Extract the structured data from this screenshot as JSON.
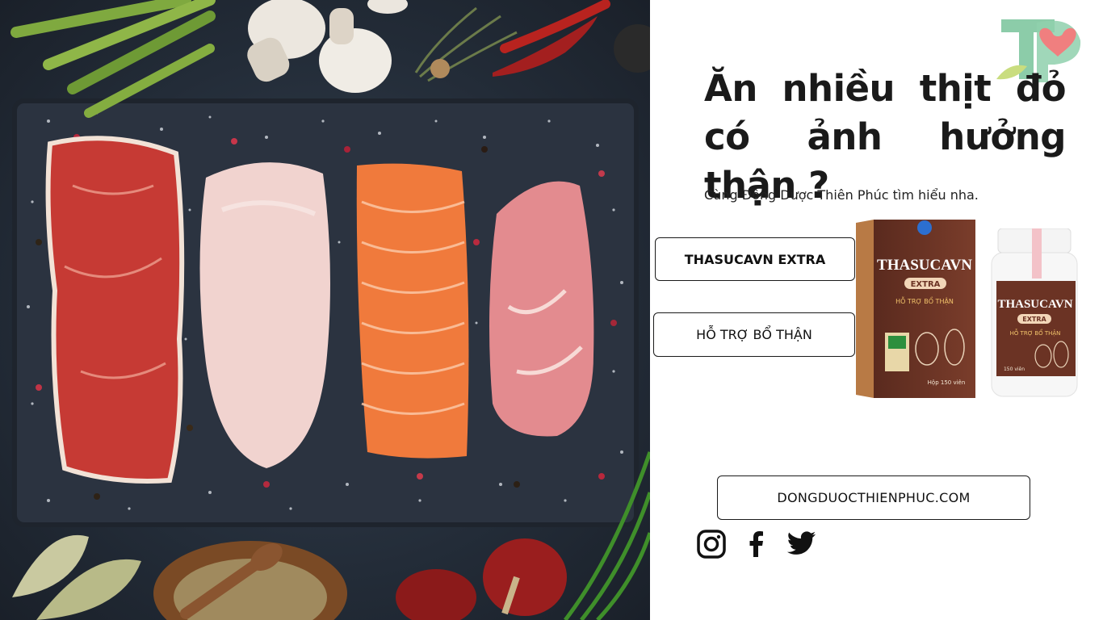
{
  "headline": "Ăn nhiều thịt đỏ có ảnh hưởng thận ?",
  "subtitle": "Cùng Đông Dược Thiên Phúc tìm hiểu nha.",
  "buttons": {
    "product_name": "THASUCAVN EXTRA",
    "product_benefit": "HỖ TRỢ BỔ THẬN",
    "website": "DONGDUOCTHIENPHUC.COM"
  },
  "product_packaging": {
    "box_brand": "THASUCAVN",
    "box_variant": "EXTRA",
    "box_tagline": "HỖ TRỢ BỔ THẬN",
    "box_count": "Hộp 150 viên",
    "jar_brand": "THASUCAVN",
    "jar_variant": "EXTRA",
    "jar_tagline": "HỖ TRỢ BỔ THẬN",
    "jar_count": "150 viên"
  },
  "socials": [
    "instagram-icon",
    "facebook-icon",
    "twitter-icon"
  ],
  "colors": {
    "logo_green": "#7fc7a0",
    "logo_heart": "#f07f7f",
    "product_brown": "#6b3324",
    "meat_red": "#c63a34",
    "salmon": "#f07a3c"
  }
}
